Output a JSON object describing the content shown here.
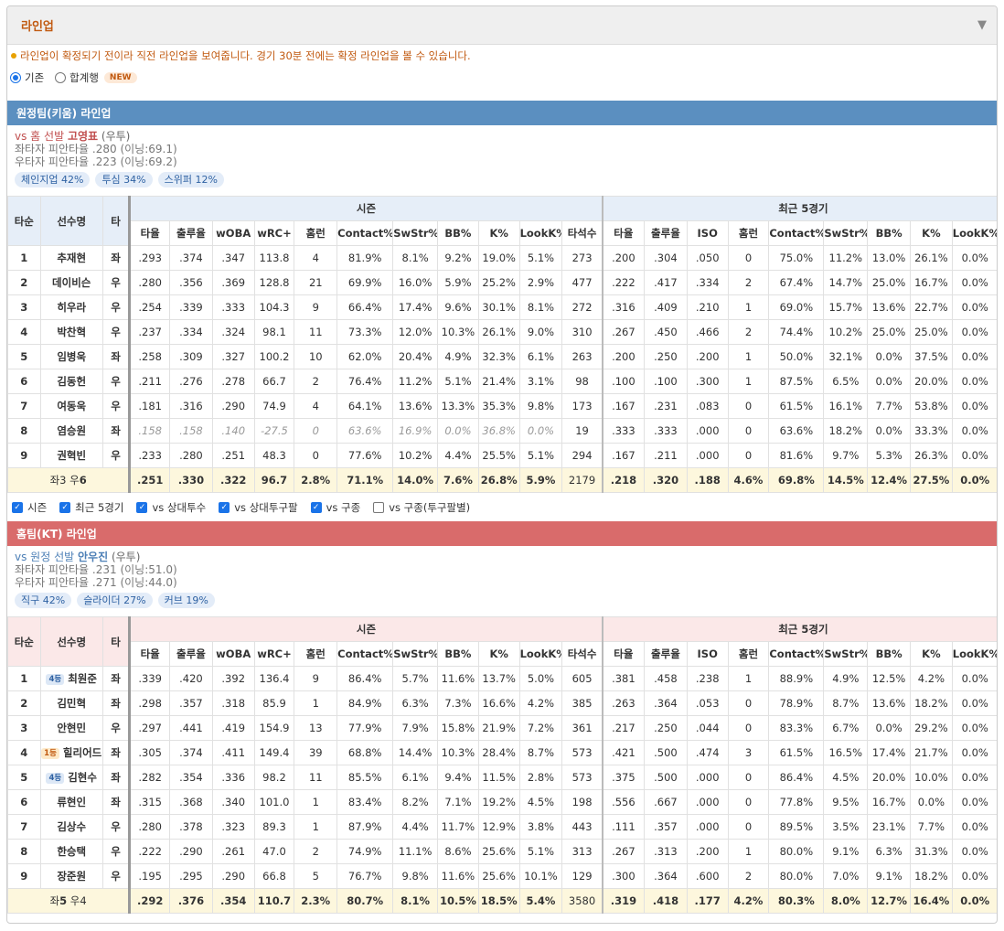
{
  "header": {
    "title": "라인업",
    "toggle": "▼"
  },
  "notice": "라인업이 확정되기 전이라 직전 라인업을 보여줍니다. 경기 30분 전에는 확정 라인업을 볼 수 있습니다.",
  "modes": {
    "basic": "기존",
    "sum": "합계행",
    "new_badge": "NEW"
  },
  "columns": {
    "order": "타순",
    "player": "선수명",
    "bat": "타",
    "season": "시즌",
    "recent": "최근 5경기",
    "season_cols": [
      "타율",
      "출루율",
      "wOBA",
      "wRC+",
      "홈런",
      "Contact%",
      "SwStr%",
      "BB%",
      "K%",
      "LookK%",
      "타석수"
    ],
    "recent_cols": [
      "타율",
      "출루율",
      "ISO",
      "홈런",
      "Contact%",
      "SwStr%",
      "BB%",
      "K%",
      "LookK%"
    ]
  },
  "away": {
    "title": "원정팀(키움) 라인업",
    "vs_prefix": "vs 홈 선발",
    "pitcher": "고영표",
    "pitch_type": "(우투)",
    "lhb_line": "좌타자 피안타율 .280 (이닝:69.1)",
    "rhb_line": "우타자 피안타율 .223 (이닝:69.2)",
    "chips": [
      "체인지업 42%",
      "투심 34%",
      "스위퍼 12%"
    ],
    "rows": [
      {
        "o": "1",
        "n": "추재현",
        "b": "좌",
        "s": [
          ".293",
          ".374",
          ".347",
          "113.8",
          "4",
          "81.9%",
          "8.1%",
          "9.2%",
          "19.0%",
          "5.1%",
          "273"
        ],
        "r": [
          ".200",
          ".304",
          ".050",
          "0",
          "75.0%",
          "11.2%",
          "13.0%",
          "26.1%",
          "0.0%"
        ]
      },
      {
        "o": "2",
        "n": "데이비슨",
        "b": "우",
        "s": [
          ".280",
          ".356",
          ".369",
          "128.8",
          "21",
          "69.9%",
          "16.0%",
          "5.9%",
          "25.2%",
          "2.9%",
          "477"
        ],
        "r": [
          ".222",
          ".417",
          ".334",
          "2",
          "67.4%",
          "14.7%",
          "25.0%",
          "16.7%",
          "0.0%"
        ]
      },
      {
        "o": "3",
        "n": "히우라",
        "b": "우",
        "s": [
          ".254",
          ".339",
          ".333",
          "104.3",
          "9",
          "66.4%",
          "17.4%",
          "9.6%",
          "30.1%",
          "8.1%",
          "272"
        ],
        "r": [
          ".316",
          ".409",
          ".210",
          "1",
          "69.0%",
          "15.7%",
          "13.6%",
          "22.7%",
          "0.0%"
        ]
      },
      {
        "o": "4",
        "n": "박찬혁",
        "b": "우",
        "s": [
          ".237",
          ".334",
          ".324",
          "98.1",
          "11",
          "73.3%",
          "12.0%",
          "10.3%",
          "26.1%",
          "9.0%",
          "310"
        ],
        "r": [
          ".267",
          ".450",
          ".466",
          "2",
          "74.4%",
          "10.2%",
          "25.0%",
          "25.0%",
          "0.0%"
        ]
      },
      {
        "o": "5",
        "n": "임병욱",
        "b": "좌",
        "s": [
          ".258",
          ".309",
          ".327",
          "100.2",
          "10",
          "62.0%",
          "20.4%",
          "4.9%",
          "32.3%",
          "6.1%",
          "263"
        ],
        "r": [
          ".200",
          ".250",
          ".200",
          "1",
          "50.0%",
          "32.1%",
          "0.0%",
          "37.5%",
          "0.0%"
        ]
      },
      {
        "o": "6",
        "n": "김동헌",
        "b": "우",
        "s": [
          ".211",
          ".276",
          ".278",
          "66.7",
          "2",
          "76.4%",
          "11.2%",
          "5.1%",
          "21.4%",
          "3.1%",
          "98"
        ],
        "r": [
          ".100",
          ".100",
          ".300",
          "1",
          "87.5%",
          "6.5%",
          "0.0%",
          "20.0%",
          "0.0%"
        ]
      },
      {
        "o": "7",
        "n": "여동욱",
        "b": "우",
        "s": [
          ".181",
          ".316",
          ".290",
          "74.9",
          "4",
          "64.1%",
          "13.6%",
          "13.3%",
          "35.3%",
          "9.8%",
          "173"
        ],
        "r": [
          ".167",
          ".231",
          ".083",
          "0",
          "61.5%",
          "16.1%",
          "7.7%",
          "53.8%",
          "0.0%"
        ]
      },
      {
        "o": "8",
        "n": "염승원",
        "b": "좌",
        "i": true,
        "s": [
          ".158",
          ".158",
          ".140",
          "-27.5",
          "0",
          "63.6%",
          "16.9%",
          "0.0%",
          "36.8%",
          "0.0%",
          "19"
        ],
        "r": [
          ".333",
          ".333",
          ".000",
          "0",
          "63.6%",
          "18.2%",
          "0.0%",
          "33.3%",
          "0.0%"
        ]
      },
      {
        "o": "9",
        "n": "권혁빈",
        "b": "우",
        "s": [
          ".233",
          ".280",
          ".251",
          "48.3",
          "0",
          "77.6%",
          "10.2%",
          "4.4%",
          "25.5%",
          "5.1%",
          "294"
        ],
        "r": [
          ".167",
          ".211",
          ".000",
          "0",
          "81.6%",
          "9.7%",
          "5.3%",
          "26.3%",
          "0.0%"
        ]
      }
    ],
    "total": {
      "pre": "좌3 우",
      "strong": "6",
      "s": [
        ".251",
        ".330",
        ".322",
        "96.7",
        "2.8%",
        "71.1%",
        "14.0%",
        "7.6%",
        "26.8%",
        "5.9%",
        "2179"
      ],
      "r": [
        ".218",
        ".320",
        ".188",
        "4.6%",
        "69.8%",
        "14.5%",
        "12.4%",
        "27.5%",
        "0.0%"
      ]
    }
  },
  "filters": [
    "시즌",
    "최근 5경기",
    "vs 상대투수",
    "vs 상대투구팔",
    "vs 구종",
    "vs 구종(투구팔별)"
  ],
  "home": {
    "title": "홈팀(KT) 라인업",
    "vs_prefix": "vs 원정 선발",
    "pitcher": "안우진",
    "pitch_type": "(우투)",
    "lhb_line": "좌타자 피안타율 .231 (이닝:51.0)",
    "rhb_line": "우타자 피안타율 .271 (이닝:44.0)",
    "chips": [
      "직구 42%",
      "슬라이더 27%",
      "커브 19%"
    ],
    "rows": [
      {
        "o": "1",
        "badge": "4등",
        "bc": "b4",
        "n": "최원준",
        "b": "좌",
        "s": [
          ".339",
          ".420",
          ".392",
          "136.4",
          "9",
          "86.4%",
          "5.7%",
          "11.6%",
          "13.7%",
          "5.0%",
          "605"
        ],
        "r": [
          ".381",
          ".458",
          ".238",
          "1",
          "88.9%",
          "4.9%",
          "12.5%",
          "4.2%",
          "0.0%"
        ]
      },
      {
        "o": "2",
        "n": "김민혁",
        "b": "좌",
        "s": [
          ".298",
          ".357",
          ".318",
          "85.9",
          "1",
          "84.9%",
          "6.3%",
          "7.3%",
          "16.6%",
          "4.2%",
          "385"
        ],
        "r": [
          ".263",
          ".364",
          ".053",
          "0",
          "78.9%",
          "8.7%",
          "13.6%",
          "18.2%",
          "0.0%"
        ]
      },
      {
        "o": "3",
        "n": "안현민",
        "b": "우",
        "s": [
          ".297",
          ".441",
          ".419",
          "154.9",
          "13",
          "77.9%",
          "7.9%",
          "15.8%",
          "21.9%",
          "7.2%",
          "361"
        ],
        "r": [
          ".217",
          ".250",
          ".044",
          "0",
          "83.3%",
          "6.7%",
          "0.0%",
          "29.2%",
          "0.0%"
        ]
      },
      {
        "o": "4",
        "badge": "1등",
        "bc": "b1",
        "n": "힐리어드",
        "b": "좌",
        "s": [
          ".305",
          ".374",
          ".411",
          "149.4",
          "39",
          "68.8%",
          "14.4%",
          "10.3%",
          "28.4%",
          "8.7%",
          "573"
        ],
        "r": [
          ".421",
          ".500",
          ".474",
          "3",
          "61.5%",
          "16.5%",
          "17.4%",
          "21.7%",
          "0.0%"
        ]
      },
      {
        "o": "5",
        "badge": "4등",
        "bc": "b4",
        "n": "김현수",
        "b": "좌",
        "s": [
          ".282",
          ".354",
          ".336",
          "98.2",
          "11",
          "85.5%",
          "6.1%",
          "9.4%",
          "11.5%",
          "2.8%",
          "573"
        ],
        "r": [
          ".375",
          ".500",
          ".000",
          "0",
          "86.4%",
          "4.5%",
          "20.0%",
          "10.0%",
          "0.0%"
        ]
      },
      {
        "o": "6",
        "n": "류현인",
        "b": "좌",
        "s": [
          ".315",
          ".368",
          ".340",
          "101.0",
          "1",
          "83.4%",
          "8.2%",
          "7.1%",
          "19.2%",
          "4.5%",
          "198"
        ],
        "r": [
          ".556",
          ".667",
          ".000",
          "0",
          "77.8%",
          "9.5%",
          "16.7%",
          "0.0%",
          "0.0%"
        ]
      },
      {
        "o": "7",
        "n": "김상수",
        "b": "우",
        "s": [
          ".280",
          ".378",
          ".323",
          "89.3",
          "1",
          "87.9%",
          "4.4%",
          "11.7%",
          "12.9%",
          "3.8%",
          "443"
        ],
        "r": [
          ".111",
          ".357",
          ".000",
          "0",
          "89.5%",
          "3.5%",
          "23.1%",
          "7.7%",
          "0.0%"
        ]
      },
      {
        "o": "8",
        "n": "한승택",
        "b": "우",
        "s": [
          ".222",
          ".290",
          ".261",
          "47.0",
          "2",
          "74.9%",
          "11.1%",
          "8.6%",
          "25.6%",
          "5.1%",
          "313"
        ],
        "r": [
          ".267",
          ".313",
          ".200",
          "1",
          "80.0%",
          "9.1%",
          "6.3%",
          "31.3%",
          "0.0%"
        ]
      },
      {
        "o": "9",
        "n": "장준원",
        "b": "우",
        "s": [
          ".195",
          ".295",
          ".290",
          "66.8",
          "5",
          "76.7%",
          "9.8%",
          "11.6%",
          "25.6%",
          "10.1%",
          "129"
        ],
        "r": [
          ".300",
          ".364",
          ".600",
          "2",
          "80.0%",
          "7.0%",
          "9.1%",
          "18.2%",
          "0.0%"
        ]
      }
    ],
    "total": {
      "pre": "좌",
      "strong": "5",
      "post": " 우4",
      "s": [
        ".292",
        ".376",
        ".354",
        "110.7",
        "2.3%",
        "80.7%",
        "8.1%",
        "10.5%",
        "18.5%",
        "5.4%",
        "3580"
      ],
      "r": [
        ".319",
        ".418",
        ".177",
        "4.2%",
        "80.3%",
        "8.0%",
        "12.7%",
        "16.4%",
        "0.0%"
      ]
    }
  },
  "colors": {
    "away_bar": "#5b8fc0",
    "home_bar": "#d96b6b",
    "accent": "#c15a11",
    "good": "#e02a2a",
    "mid": "#2a9d4a"
  }
}
